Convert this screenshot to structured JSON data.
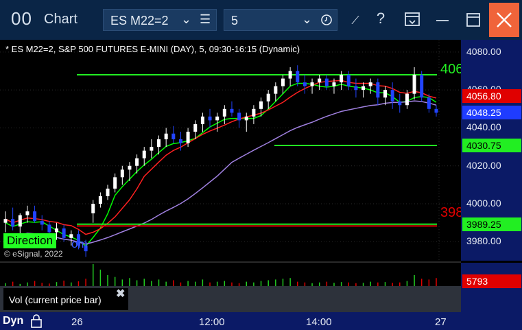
{
  "titlebar": {
    "app_glyph": "00",
    "title": "Chart",
    "symbol": "ES M22=2",
    "interval": "5",
    "icons": [
      "chevron-down-icon",
      "list-icon",
      "clock-icon",
      "draw-icon",
      "help-icon",
      "template-icon",
      "maximize-icon",
      "close-icon"
    ],
    "accent_color": "#f0643a"
  },
  "chart": {
    "header": "* ES M22=2, S&P 500 FUTURES E-MINI (DAY), 5, 09:30-16:15 (Dynamic)",
    "copyright": "© eSignal, 2022",
    "direction_label": "Direction",
    "direction_tail": "om",
    "right_line_label_top": "406",
    "right_line_label_bottom": "398",
    "price_ticks": [
      "4080.00",
      "4060.00",
      "4040.00",
      "4020.00",
      "4000.00",
      "3980.00"
    ],
    "price_labels": [
      {
        "text": "4056.80",
        "color": "#e00000",
        "price": 4056.8
      },
      {
        "text": "4048.25",
        "color": "#1f3cff",
        "price": 4048.25
      },
      {
        "text": "4030.75",
        "color": "#22ee22",
        "price": 4030.75
      },
      {
        "text": "3989.25",
        "color": "#22ee22",
        "price": 3989.25
      }
    ],
    "volume_value": "5793",
    "volume_panel_label": "Vol (current price bar)",
    "time_labels": [
      "26",
      "12:00",
      "14:00",
      "27"
    ],
    "dyn_label": "Dyn"
  },
  "chart_data": {
    "type": "candlestick",
    "ylim": [
      3970,
      4085
    ],
    "series": [
      {
        "name": "price",
        "color_up": "#ffffff",
        "color_down": "#2244ff"
      },
      {
        "name": "avg_line_1",
        "color": "#00ff00"
      },
      {
        "name": "avg_line_2",
        "color": "#a080e0"
      },
      {
        "name": "avg_line_3",
        "color": "#ff2020"
      }
    ],
    "candles": [
      [
        3990,
        3996,
        3985,
        3992
      ],
      [
        3992,
        3998,
        3986,
        3988
      ],
      [
        3988,
        3995,
        3982,
        3994
      ],
      [
        3994,
        3999,
        3990,
        3996
      ],
      [
        3996,
        3999,
        3990,
        3991
      ],
      [
        3991,
        3994,
        3986,
        3989
      ],
      [
        3989,
        3991,
        3983,
        3985
      ],
      [
        3985,
        3990,
        3981,
        3987
      ],
      [
        3987,
        3989,
        3980,
        3982
      ],
      [
        3982,
        3986,
        3978,
        3984
      ],
      [
        3984,
        3986,
        3976,
        3978
      ],
      [
        3978,
        3981,
        3972,
        3975
      ],
      [
        3995,
        4002,
        3990,
        4000
      ],
      [
        4000,
        4006,
        3998,
        4004
      ],
      [
        4004,
        4010,
        4002,
        4008
      ],
      [
        4008,
        4016,
        4006,
        4014
      ],
      [
        4014,
        4020,
        4010,
        4018
      ],
      [
        4018,
        4022,
        4012,
        4020
      ],
      [
        4020,
        4026,
        4016,
        4024
      ],
      [
        4024,
        4030,
        4020,
        4028
      ],
      [
        4028,
        4034,
        4024,
        4030
      ],
      [
        4030,
        4036,
        4026,
        4034
      ],
      [
        4034,
        4040,
        4030,
        4037
      ],
      [
        4037,
        4041,
        4032,
        4034
      ],
      [
        4034,
        4038,
        4028,
        4032
      ],
      [
        4032,
        4040,
        4030,
        4038
      ],
      [
        4038,
        4044,
        4034,
        4042
      ],
      [
        4042,
        4048,
        4038,
        4046
      ],
      [
        4046,
        4050,
        4040,
        4044
      ],
      [
        4044,
        4048,
        4038,
        4046
      ],
      [
        4046,
        4052,
        4042,
        4050
      ],
      [
        4050,
        4054,
        4046,
        4048
      ],
      [
        4048,
        4050,
        4040,
        4044
      ],
      [
        4044,
        4048,
        4038,
        4046
      ],
      [
        4046,
        4052,
        4042,
        4050
      ],
      [
        4050,
        4056,
        4046,
        4054
      ],
      [
        4054,
        4060,
        4050,
        4058
      ],
      [
        4058,
        4064,
        4054,
        4062
      ],
      [
        4062,
        4068,
        4058,
        4066
      ],
      [
        4066,
        4072,
        4062,
        4070
      ],
      [
        4070,
        4073,
        4062,
        4064
      ],
      [
        4064,
        4068,
        4058,
        4062
      ],
      [
        4062,
        4066,
        4058,
        4064
      ],
      [
        4064,
        4068,
        4060,
        4066
      ],
      [
        4066,
        4068,
        4060,
        4062
      ],
      [
        4062,
        4066,
        4058,
        4064
      ],
      [
        4064,
        4070,
        4060,
        4068
      ],
      [
        4068,
        4070,
        4060,
        4062
      ],
      [
        4062,
        4066,
        4056,
        4060
      ],
      [
        4060,
        4064,
        4056,
        4062
      ],
      [
        4062,
        4066,
        4058,
        4064
      ],
      [
        4064,
        4066,
        4052,
        4056
      ],
      [
        4056,
        4062,
        4052,
        4060
      ],
      [
        4060,
        4064,
        4050,
        4054
      ],
      [
        4054,
        4058,
        4048,
        4052
      ],
      [
        4052,
        4060,
        4050,
        4058
      ],
      [
        4058,
        4072,
        4055,
        4068
      ],
      [
        4068,
        4070,
        4054,
        4056
      ],
      [
        4056,
        4058,
        4048,
        4050
      ],
      [
        4050,
        4052,
        4046,
        4048
      ]
    ],
    "volume": [
      8,
      12,
      6,
      10,
      14,
      9,
      7,
      11,
      15,
      10,
      13,
      20,
      60,
      45,
      30,
      25,
      18,
      22,
      16,
      20,
      14,
      18,
      12,
      16,
      10,
      14,
      12,
      18,
      10,
      12,
      14,
      10,
      8,
      12,
      10,
      14,
      16,
      18,
      20,
      22,
      12,
      10,
      8,
      10,
      12,
      9,
      11,
      10,
      8,
      9,
      12,
      10,
      11,
      9,
      10,
      14,
      30,
      20,
      18,
      22
    ]
  }
}
